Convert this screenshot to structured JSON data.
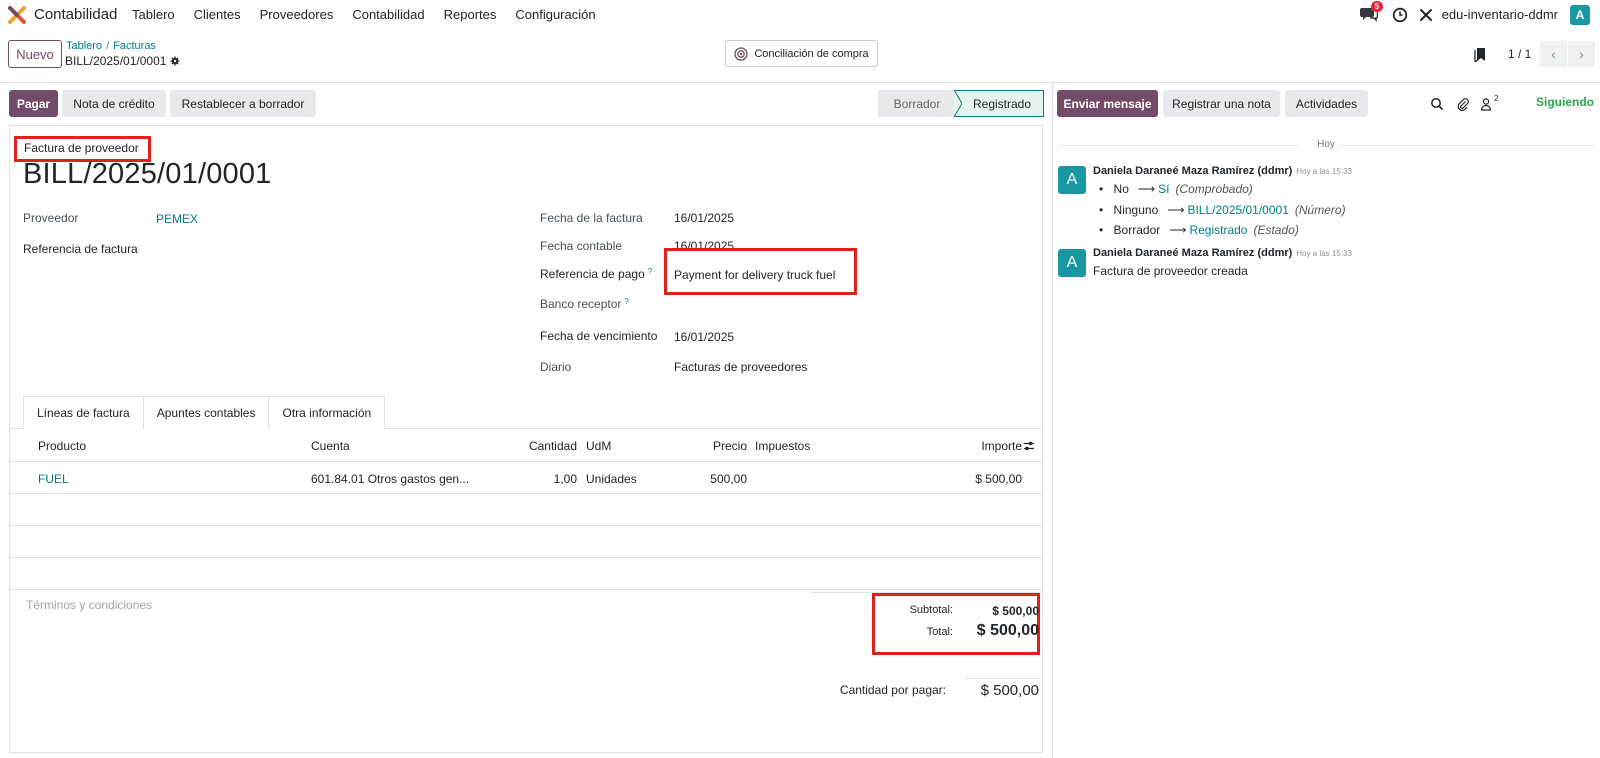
{
  "nav": {
    "app_name": "Contabilidad",
    "menu": [
      "Tablero",
      "Clientes",
      "Proveedores",
      "Contabilidad",
      "Reportes",
      "Configuración"
    ],
    "messages_badge": "5",
    "company": "edu-inventario-ddmr",
    "user_initial": "A"
  },
  "control": {
    "new_label": "Nuevo",
    "breadcrumb": [
      "Tablero",
      "Facturas"
    ],
    "record_name": "BILL/2025/01/0001",
    "reconcile_label": "Conciliación de compra",
    "pager": "1 / 1"
  },
  "actions": {
    "pay": "Pagar",
    "credit_note": "Nota de crédito",
    "reset_draft": "Restablecer a borrador",
    "stages": [
      "Borrador",
      "Registrado"
    ],
    "current_stage": "Registrado"
  },
  "form": {
    "move_type": "Factura de proveedor",
    "name": "BILL/2025/01/0001",
    "vendor_label": "Proveedor",
    "vendor": "PEMEX",
    "bill_ref_label": "Referencia de factura",
    "invoice_date_label": "Fecha de la factura",
    "invoice_date": "16/01/2025",
    "accounting_date_label": "Fecha contable",
    "accounting_date": "16/01/2025",
    "payment_ref_label": "Referencia de pago",
    "payment_ref": "Payment for delivery truck fuel",
    "bank_label": "Banco receptor",
    "due_date_label": "Fecha de vencimiento",
    "due_date": "16/01/2025",
    "journal_label": "Diario",
    "journal": "Facturas de proveedores",
    "help_mark": "?"
  },
  "tabs": [
    "Líneas de factura",
    "Apuntes contables",
    "Otra información"
  ],
  "lines": {
    "headers": {
      "product": "Producto",
      "account": "Cuenta",
      "qty": "Cantidad",
      "uom": "UdM",
      "price": "Precio",
      "taxes": "Impuestos",
      "amount": "Importe"
    },
    "rows": [
      {
        "product": "FUEL",
        "account": "601.84.01 Otros gastos gen...",
        "qty": "1,00",
        "uom": "Unidades",
        "price": "500,00",
        "taxes": "",
        "amount": "$ 500,00"
      }
    ]
  },
  "totals": {
    "terms_placeholder": "Términos y condiciones",
    "subtotal_label": "Subtotal:",
    "subtotal": "$ 500,00",
    "total_label": "Total:",
    "total": "$ 500,00",
    "due_label": "Cantidad por pagar:",
    "due": "$ 500,00"
  },
  "chatter": {
    "send_message": "Enviar mensaje",
    "log_note": "Registrar una nota",
    "activities": "Actividades",
    "followers_count": "2",
    "following": "Siguiendo",
    "date_separator": "Hoy",
    "messages": [
      {
        "author": "Daniela Daraneé Maza Ramírez (ddmr)",
        "time": "Hoy a las 15:33",
        "avatar": "A",
        "changes": [
          {
            "old": "No",
            "new": "Sí",
            "field": "(Comprobado)"
          },
          {
            "old": "Ninguno",
            "new": "BILL/2025/01/0001",
            "field": "(Número)"
          },
          {
            "old": "Borrador",
            "new": "Registrado",
            "field": "(Estado)"
          }
        ]
      },
      {
        "author": "Daniela Daraneé Maza Ramírez (ddmr)",
        "time": "Hoy a las 15:33",
        "avatar": "A",
        "body": "Factura de proveedor creada"
      }
    ]
  },
  "colors": {
    "brand": "#714b67",
    "link": "#017e84",
    "avatar": "#1a97a2",
    "highlight": "#e0201b",
    "following": "#28a745"
  }
}
